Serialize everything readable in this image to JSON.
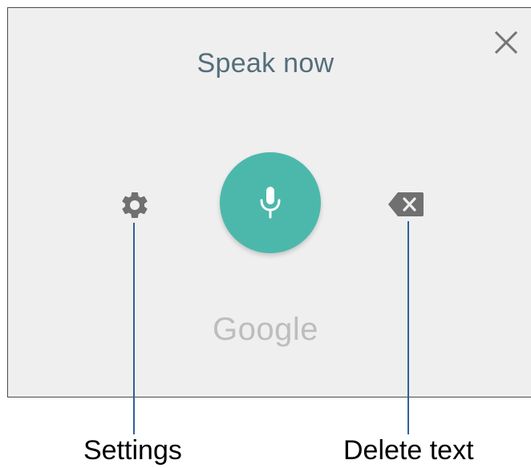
{
  "dialog": {
    "title": "Speak now",
    "brand": "Google",
    "accent_color": "#4cb8ab",
    "title_color": "#546e7a"
  },
  "controls": {
    "close": {
      "icon": "close-icon"
    },
    "settings": {
      "icon": "gear-icon"
    },
    "microphone": {
      "icon": "microphone-icon"
    },
    "delete": {
      "icon": "backspace-icon"
    }
  },
  "callouts": {
    "settings_label": "Settings",
    "delete_label": "Delete text",
    "line_color": "#2f5f9a"
  }
}
